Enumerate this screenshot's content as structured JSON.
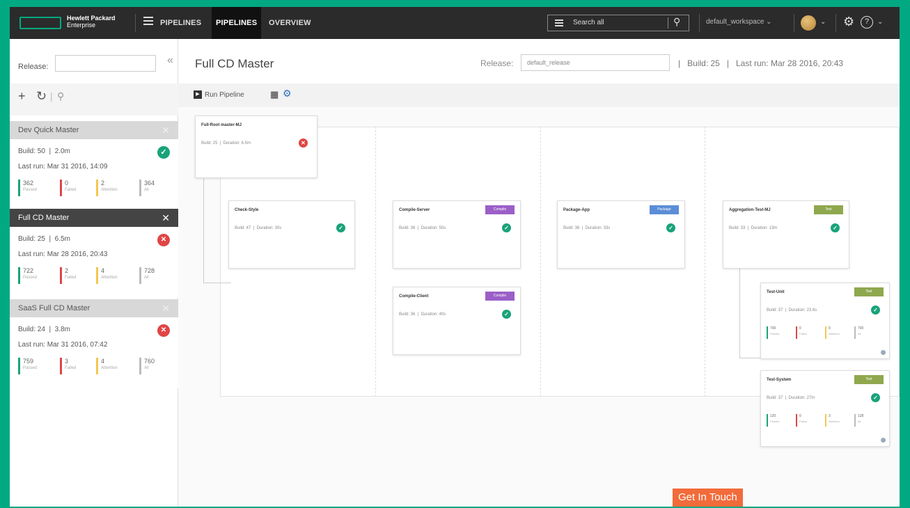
{
  "header": {
    "logo_line1": "Hewlett Packard",
    "logo_line2": "Enterprise",
    "nav": [
      {
        "label": "PIPELINES",
        "active": false
      },
      {
        "label": "PIPELINES",
        "active": true
      },
      {
        "label": "OVERVIEW",
        "active": false
      }
    ],
    "search_placeholder": "Search all",
    "workspace": "default_workspace",
    "icons": [
      "menu-icon",
      "search-icon",
      "avatar",
      "gear-icon",
      "help-icon"
    ]
  },
  "sidebar": {
    "release_label": "Release:",
    "release_value": "",
    "pipelines": [
      {
        "name": "Dev Quick Master",
        "build": "Build: 50",
        "duration": "2.0m",
        "last_run_label": "Last run:",
        "last_run": "Mar 31 2016, 14:09",
        "status": "passed",
        "stats": [
          {
            "v": "362",
            "l": "Passed",
            "c": "#1aa37a"
          },
          {
            "v": "0",
            "l": "Failed",
            "c": "#e04545"
          },
          {
            "v": "2",
            "l": "Attention",
            "c": "#f3c74f"
          },
          {
            "v": "364",
            "l": "All",
            "c": "#bbbbbb"
          }
        ],
        "active": false
      },
      {
        "name": "Full CD Master",
        "build": "Build: 25",
        "duration": "6.5m",
        "last_run_label": "Last run:",
        "last_run": "Mar 28 2016, 20:43",
        "status": "failed",
        "stats": [
          {
            "v": "722",
            "l": "Passed",
            "c": "#1aa37a"
          },
          {
            "v": "2",
            "l": "Failed",
            "c": "#e04545"
          },
          {
            "v": "4",
            "l": "Attention",
            "c": "#f3c74f"
          },
          {
            "v": "728",
            "l": "All",
            "c": "#bbbbbb"
          }
        ],
        "active": true
      },
      {
        "name": "SaaS Full CD Master",
        "build": "Build: 24",
        "duration": "3.8m",
        "last_run_label": "Last run:",
        "last_run": "Mar 31 2016, 07:42",
        "status": "failed",
        "stats": [
          {
            "v": "759",
            "l": "Passed",
            "c": "#1aa37a"
          },
          {
            "v": "3",
            "l": "Failed",
            "c": "#e04545"
          },
          {
            "v": "4",
            "l": "Attention",
            "c": "#f3c74f"
          },
          {
            "v": "760",
            "l": "All",
            "c": "#bbbbbb"
          }
        ],
        "active": false
      }
    ]
  },
  "main": {
    "title": "Full CD Master",
    "release_label": "Release:",
    "release_value": "default_release",
    "build": "Build: 25",
    "last_run": "Last run: Mar 28 2016, 20:43",
    "run_label": "Run Pipeline",
    "get_in_touch": "Get In Touch"
  },
  "jobs": [
    {
      "name": "Full-Root master-MJ",
      "build": "Build: 25",
      "duration": "Duration: 6.5m",
      "status": "failed",
      "tag": ""
    },
    {
      "name": "Check-Style",
      "build": "Build: 47",
      "duration": "Duration: 30s",
      "status": "passed",
      "tag": ""
    },
    {
      "name": "Compile-Server",
      "build": "Build: 36",
      "duration": "Duration: 50s",
      "status": "passed",
      "tag": "Compile",
      "tag_color": "#9b5fc7"
    },
    {
      "name": "Compile-Client",
      "build": "Build: 36",
      "duration": "Duration: 40s",
      "status": "passed",
      "tag": "Compile",
      "tag_color": "#9b5fc7"
    },
    {
      "name": "Package-App",
      "build": "Build: 36",
      "duration": "Duration: 33s",
      "status": "passed",
      "tag": "Package",
      "tag_color": "#5b8ed6"
    },
    {
      "name": "Aggregation-Test-MJ",
      "build": "Build: 33",
      "duration": "Duration: 13m",
      "status": "passed",
      "tag": "Test",
      "tag_color": "#8fa84e"
    },
    {
      "name": "Test-Unit",
      "build": "Build: 37",
      "duration": "Duration: 23.6s",
      "status": "passed",
      "tag": "Test",
      "tag_color": "#8fa84e",
      "stats": [
        {
          "v": "700",
          "l": "Passed",
          "c": "#1aa37a"
        },
        {
          "v": "0",
          "l": "Failed",
          "c": "#e04545"
        },
        {
          "v": "0",
          "l": "Attention",
          "c": "#f3c74f"
        },
        {
          "v": "700",
          "l": "All",
          "c": "#bbbbbb"
        }
      ]
    },
    {
      "name": "Test-System",
      "build": "Build: 37",
      "duration": "Duration: 27m",
      "status": "passed",
      "tag": "Test",
      "tag_color": "#8fa84e",
      "stats": [
        {
          "v": "120",
          "l": "Passed",
          "c": "#1aa37a"
        },
        {
          "v": "0",
          "l": "Failed",
          "c": "#e04545"
        },
        {
          "v": "3",
          "l": "Attention",
          "c": "#f3c74f"
        },
        {
          "v": "128",
          "l": "All",
          "c": "#bbbbbb"
        }
      ]
    }
  ]
}
